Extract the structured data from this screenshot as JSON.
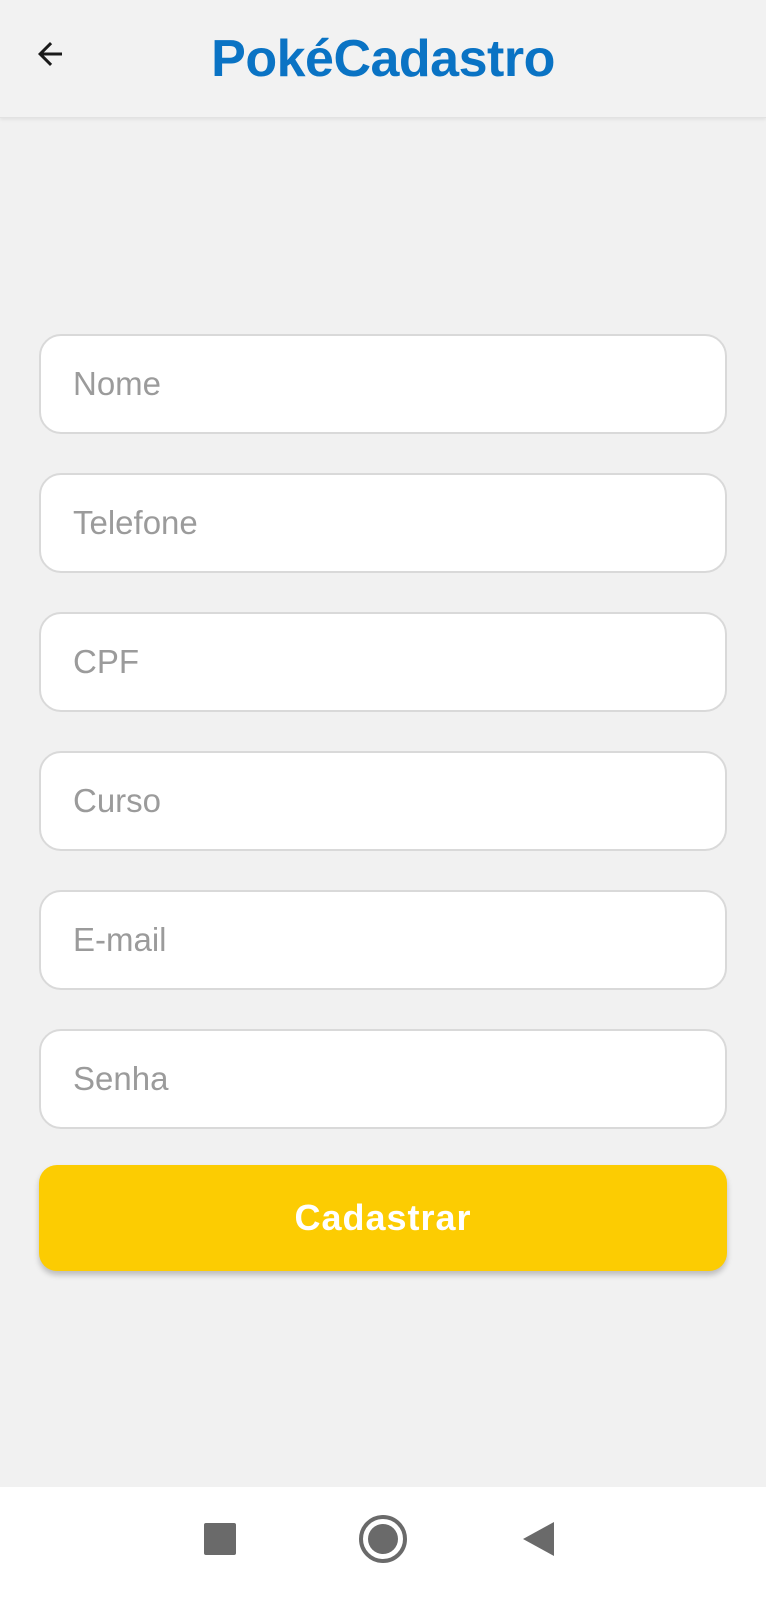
{
  "header": {
    "back_icon": "arrow-left-icon",
    "title": "PokéCadastro"
  },
  "form": {
    "fields": [
      {
        "name": "nome",
        "placeholder": "Nome",
        "value": ""
      },
      {
        "name": "telefone",
        "placeholder": "Telefone",
        "value": ""
      },
      {
        "name": "cpf",
        "placeholder": "CPF",
        "value": ""
      },
      {
        "name": "curso",
        "placeholder": "Curso",
        "value": ""
      },
      {
        "name": "email",
        "placeholder": "E-mail",
        "value": ""
      },
      {
        "name": "senha",
        "placeholder": "Senha",
        "value": ""
      }
    ],
    "submit_label": "Cadastrar"
  },
  "system_nav": {
    "recents_icon": "square-icon",
    "home_icon": "circle-icon",
    "back_icon": "triangle-back-icon"
  },
  "colors": {
    "brand_blue": "#0a73c4",
    "accent_yellow": "#fccc02",
    "background": "#f1f1f1",
    "nav_icon": "#6a6a6a"
  }
}
